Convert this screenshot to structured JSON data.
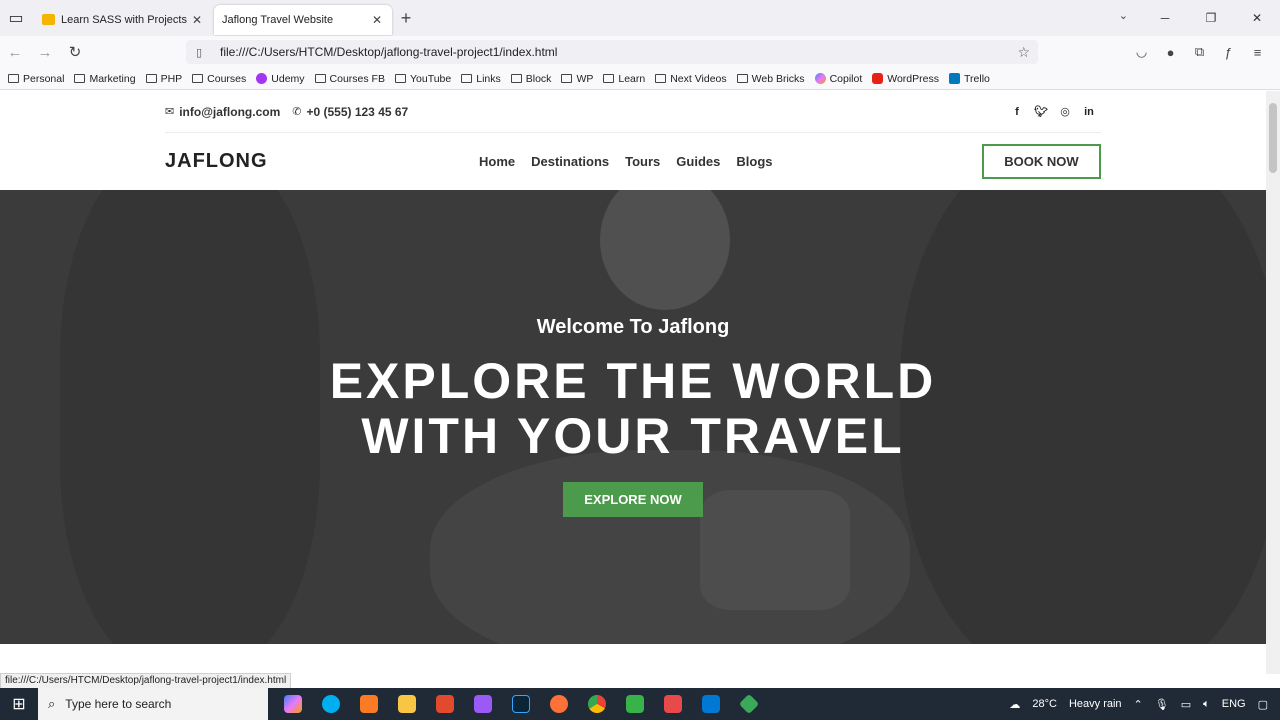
{
  "browser": {
    "tabs": [
      {
        "title": "Learn SASS with Projects - Goo",
        "active": false
      },
      {
        "title": "Jaflong Travel Website",
        "active": true
      }
    ],
    "url": "file:///C:/Users/HTCM/Desktop/jaflong-travel-project1/index.html",
    "bookmarks": [
      "Personal",
      "Marketing",
      "PHP",
      "Courses",
      "Udemy",
      "Courses FB",
      "YouTube",
      "Links",
      "Block",
      "WP",
      "Learn",
      "Next Videos",
      "Web Bricks",
      "Copilot",
      "WordPress",
      "Trello"
    ],
    "status_link": "file:///C:/Users/HTCM/Desktop/jaflong-travel-project1/index.html"
  },
  "site": {
    "contact": {
      "email": "info@jaflong.com",
      "phone": "+0 (555) 123 45 67"
    },
    "social": [
      "f",
      "t",
      "ig",
      "in"
    ],
    "logo": "JAFLONG",
    "menu": [
      "Home",
      "Destinations",
      "Tours",
      "Guides",
      "Blogs"
    ],
    "book_label": "BOOK NOW",
    "hero": {
      "welcome": "Welcome To Jaflong",
      "headline_line1": "EXPLORE THE WORLD",
      "headline_line2": "WITH YOUR TRAVEL",
      "cta": "EXPLORE NOW"
    }
  },
  "taskbar": {
    "search_placeholder": "Type here to search",
    "temperature": "28°C",
    "weather": "Heavy rain",
    "lang": "ENG"
  },
  "colors": {
    "accent": "#4c9a4c",
    "hero_overlay": "#3b3b3b"
  }
}
